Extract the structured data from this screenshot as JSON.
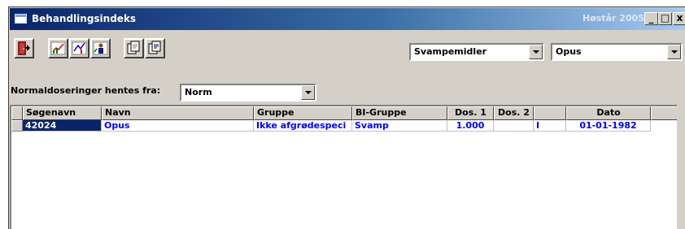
{
  "window": {
    "title": "Behandlingsindeks",
    "season": "Høstår 2005",
    "controls": {
      "minimize": "_",
      "maximize": "□",
      "close": "x"
    }
  },
  "toolbar": {
    "icons": [
      "exit-door-icon",
      "chart-1-icon",
      "chart-2-icon",
      "chart-person-icon",
      "copy-1-icon",
      "copy-2-icon"
    ]
  },
  "filters": {
    "category": "Svampemidler",
    "product": "Opus"
  },
  "norm": {
    "label": "Normaldoseringer hentes fra:",
    "value": "Norm"
  },
  "table": {
    "columns": [
      "Søgenavn",
      "Navn",
      "Gruppe",
      "BI-Gruppe",
      "Dos. 1",
      "Dos. 2",
      "",
      "Dato"
    ],
    "rows": [
      [
        "42024",
        "Opus",
        "Ikke afgrødespeci",
        "Svamp",
        "1.000",
        "",
        "I",
        "01-01-1982"
      ]
    ]
  },
  "colors": {
    "titlebar_start": "#0a246a",
    "titlebar_end": "#a6caf0",
    "face": "#d4d0c8",
    "row_text": "#0000ff",
    "selection": "#0a246a"
  }
}
